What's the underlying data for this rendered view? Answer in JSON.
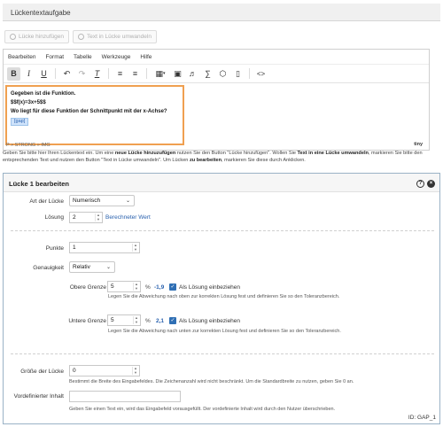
{
  "section": {
    "title": "Lückentextaufgabe"
  },
  "buttons": {
    "add_gap": "Lücke hinzufügen",
    "convert_gap": "Text in Lücke umwandeln"
  },
  "editor": {
    "menu": [
      "Bearbeiten",
      "Format",
      "Tabelle",
      "Werkzeuge",
      "Hilfe"
    ],
    "toolbar_icons": [
      "bold-icon",
      "italic-icon",
      "underline-icon",
      "undo-icon",
      "redo-icon",
      "clear-format-icon",
      "bullet-list-icon",
      "numbered-list-icon",
      "table-icon",
      "image-icon",
      "media-icon",
      "formula-icon",
      "shape-icon",
      "comment-icon",
      "code-icon"
    ],
    "content": {
      "line1": "Gegeben ist die Funktion.",
      "line2": "$$f(x)=3x+5$$",
      "line3": "Wo liegt für diese Funktion der Schnittpunkt mit der x-Achse?",
      "gap": "[gap]"
    },
    "status_path": "P » STRONG » IMG",
    "brand": "tiny"
  },
  "help_text": {
    "a": "Geben Sie bitte hier Ihren Lückentext ein. Um eine ",
    "a_bold": "neue Lücke hinzuzufügen",
    "b": " nutzen Sie den Button \"Lücke hinzufügen\". Wollen Sie ",
    "b_bold": "Text in eine Lücke umwandeln",
    "c": ", markieren Sie bitte den entsprechenden Text und nutzen den Button \"Text in Lücke umwandeln\". Um Lücken ",
    "c_bold": "zu bearbeiten",
    "d": ", markieren Sie diese durch Anklicken."
  },
  "panel": {
    "title": "Lücke 1 bearbeiten",
    "gap_type_label": "Art der Lücke",
    "gap_type_value": "Numerisch",
    "solution_label": "Lösung",
    "solution_value": "2",
    "computed_link": "Berechneter Wert",
    "points_label": "Punkte",
    "points_value": "1",
    "precision_label": "Genauigkeit",
    "precision_value": "Relativ",
    "upper_label": "Obere Grenze",
    "upper_value": "5",
    "upper_pct": "%",
    "upper_result": "-1,9",
    "upper_check": "Als Lösung einbeziehen",
    "upper_desc": "Legen Sie die Abweichung nach oben zur korrekten Lösung fest und definieren Sie so den Toleranzbereich.",
    "lower_label": "Untere Grenze",
    "lower_value": "5",
    "lower_pct": "%",
    "lower_result": "2,1",
    "lower_check": "Als Lösung einbeziehen",
    "lower_desc": "Legen Sie die Abweichung nach unten zur korrekten Lösung fest und definieren Sie so den Toleranzbereich.",
    "size_label": "Größe der Lücke",
    "size_value": "0",
    "size_desc": "Bestimmt die Breite des Eingabefeldes. Die Zeichenanzahl wird nicht beschränkt. Um die Standardbreite zu nutzen, geben Sie 0 an.",
    "prefilled_label": "Vordefinierter Inhalt",
    "prefilled_value": "",
    "prefilled_desc": "Geben Sie einen Text ein, wird das Eingabefeld vorausgefüllt. Der vordefinierte Inhalt wird durch den Nutzer überschrieben.",
    "gap_id": "ID: GAP_1"
  }
}
